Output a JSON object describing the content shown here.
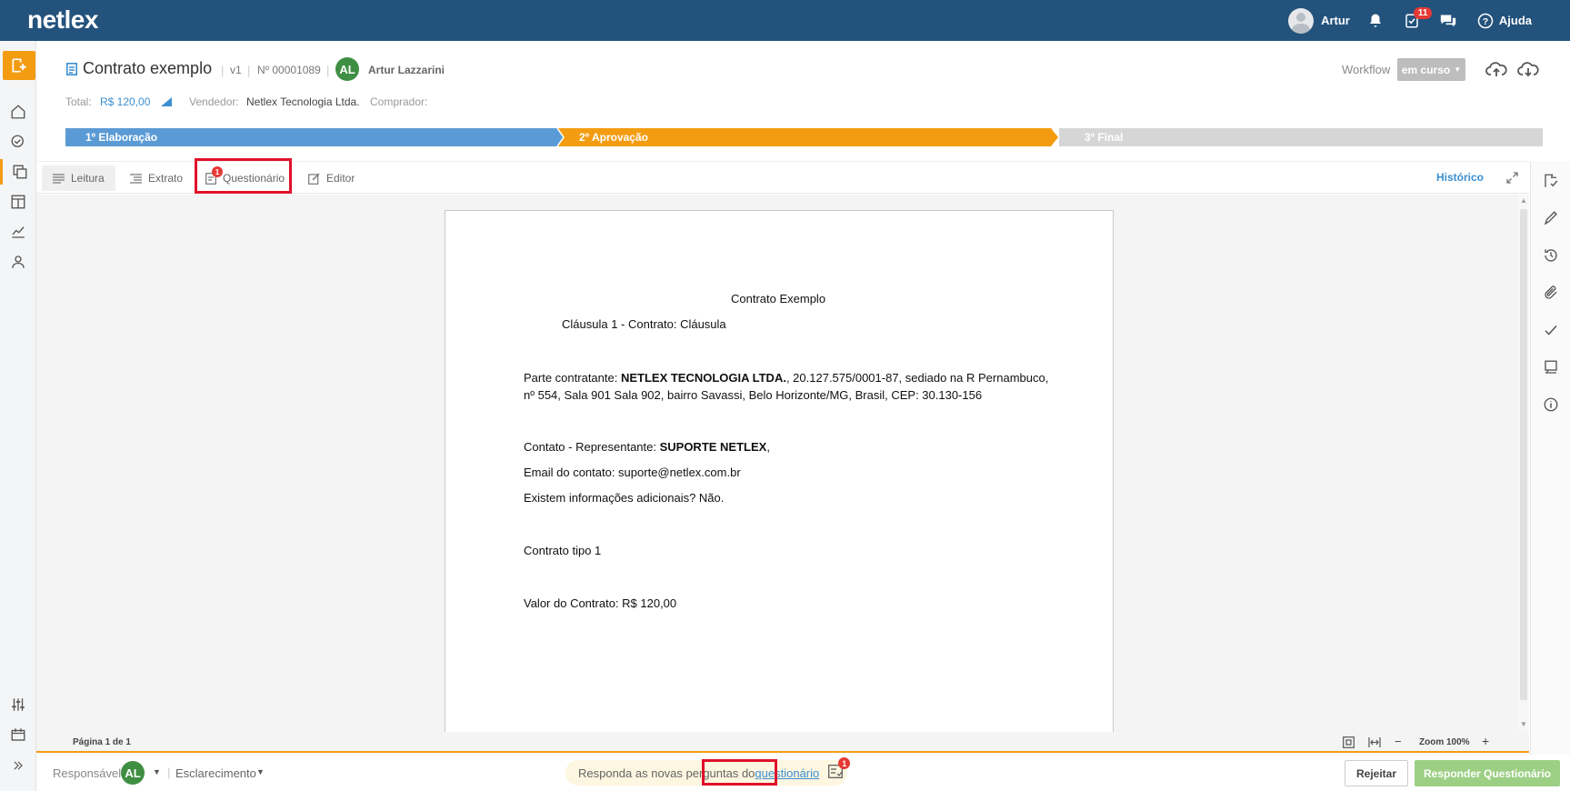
{
  "topbar": {
    "logo": "netlex",
    "user_name": "Artur",
    "tasks_badge": "11",
    "help_label": "Ajuda"
  },
  "document": {
    "title": "Contrato exemplo",
    "version": "v1",
    "number": "Nº 00001089",
    "owner_initials": "AL",
    "owner_name": "Artur Lazzarini",
    "total_label": "Total:",
    "total_value": "R$ 120,00",
    "seller_label": "Vendedor:",
    "seller_value": "Netlex Tecnologia Ltda.",
    "buyer_label": "Comprador:"
  },
  "workflow": {
    "label": "Workflow",
    "status": "em curso"
  },
  "steps": [
    {
      "label": "1º Elaboração",
      "color": "#5b9bd5"
    },
    {
      "label": "2º Aprovação",
      "color": "#f39c12"
    },
    {
      "label": "3º Final",
      "color": "#d6d6d6"
    }
  ],
  "tabs": {
    "leitura": "Leitura",
    "extrato": "Extrato",
    "questionario": "Questionário",
    "questionario_badge": "1",
    "editor": "Editor",
    "historico": "Histórico"
  },
  "page": {
    "heading": "Contrato Exemplo",
    "clause": "Cláusula 1 - Contrato: Cláusula",
    "party_prefix": "Parte contratante: ",
    "party_name": "NETLEX TECNOLOGIA LTDA.",
    "party_rest": ", 20.127.575/0001-87, sediado na R Pernambuco,",
    "party_line2": "nº 554, Sala 901 Sala 902, bairro Savassi, Belo Horizonte/MG, Brasil, CEP: 30.130-156",
    "contact_prefix": "Contato - Representante: ",
    "contact_name": "SUPORTE NETLEX",
    "contact_suffix": ",",
    "email_line": "Email do contato: suporte@netlex.com.br",
    "info_line": "Existem informações adicionais? Não.",
    "type_line": "Contrato tipo 1",
    "value_line": "Valor do Contrato: R$ 120,00"
  },
  "status": {
    "page_info": "Página 1 de 1",
    "zoom": "Zoom 100%"
  },
  "bottom": {
    "responsible_label": "Responsável",
    "responsible_initials": "AL",
    "clarification": "Esclarecimento",
    "notice_text": "Responda as novas perguntas do ",
    "notice_link": "questionário",
    "notice_badge": "1",
    "reject_label": "Rejeitar",
    "answer_label": "Responder Questionário"
  }
}
